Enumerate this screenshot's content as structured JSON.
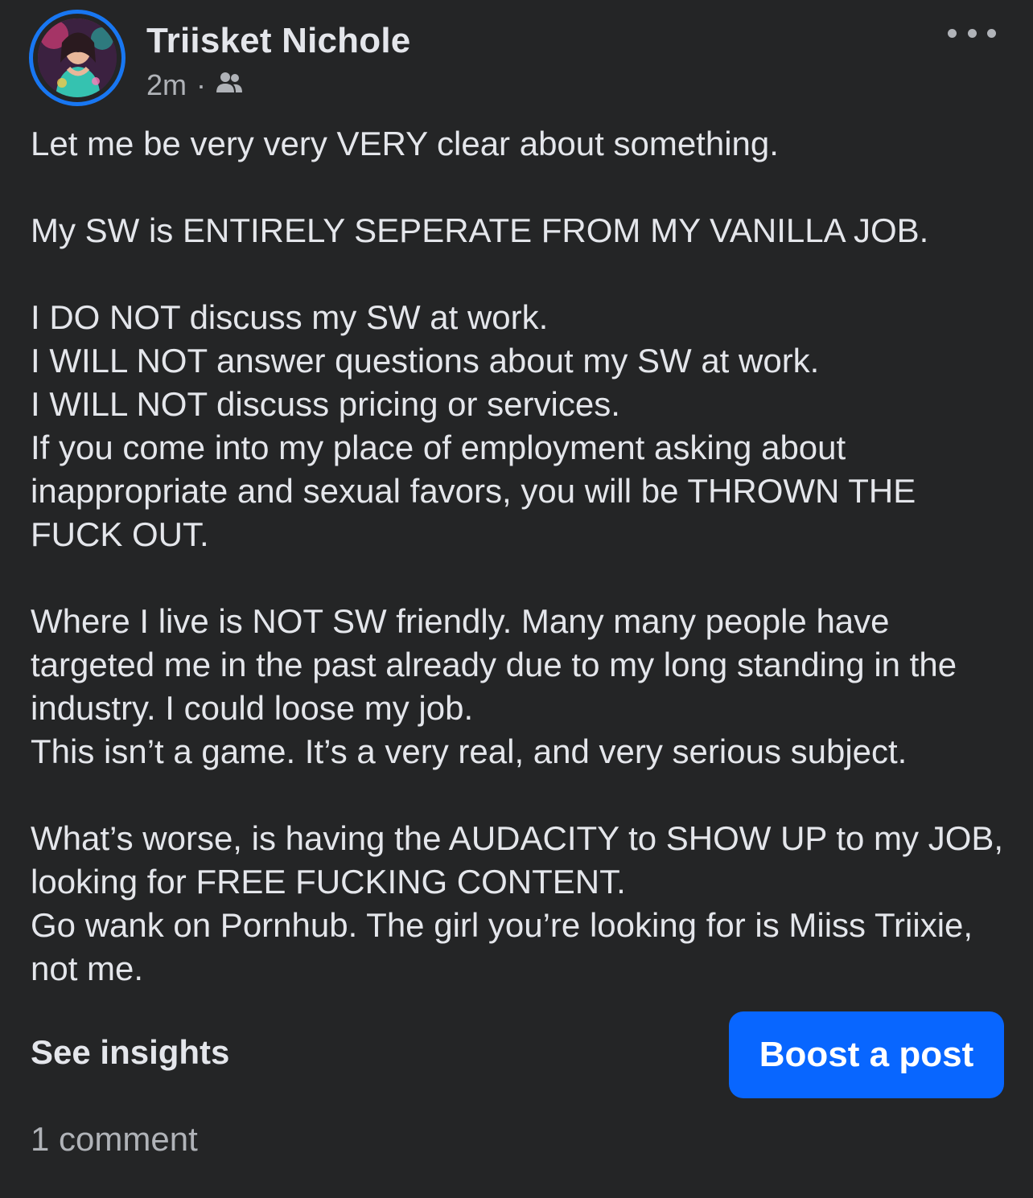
{
  "post": {
    "author": "Triisket Nichole",
    "timestamp": "2m",
    "separator": "·",
    "audience_icon": "friends-icon",
    "more_icon": "more-options-icon",
    "avatar_icon": "profile-avatar",
    "body": {
      "line_1": "Let me be very very VERY clear about something.",
      "line_2": "My SW is ENTIRELY SEPERATE FROM MY VANILLA JOB.",
      "line_3": "I DO NOT discuss my SW at work.",
      "line_4": "I WILL NOT answer questions about my SW at work.",
      "line_5": "I WILL NOT discuss pricing or services.",
      "line_6": "If you come into my place of employment asking about inappropriate and sexual favors, you will be THROWN THE FUCK OUT.",
      "line_7": "Where I live is NOT SW friendly. Many many people have targeted me in the past already due to my long standing in the industry. I could loose my job.",
      "line_8": "This isn’t a game. It’s a very real, and very serious subject.",
      "line_9": "What’s worse, is having the AUDACITY to SHOW UP to my JOB, looking for FREE FUCKING CONTENT.",
      "line_10": "Go wank on Pornhub. The girl you’re looking for is Miiss Triixie, not me."
    },
    "see_insights_label": "See insights",
    "boost_label": "Boost a post",
    "comments_label": "1 comment"
  },
  "colors": {
    "background": "#242526",
    "text_primary": "#e4e6eb",
    "text_secondary": "#b0b3b8",
    "accent": "#0866ff",
    "avatar_ring": "#1877f2"
  }
}
